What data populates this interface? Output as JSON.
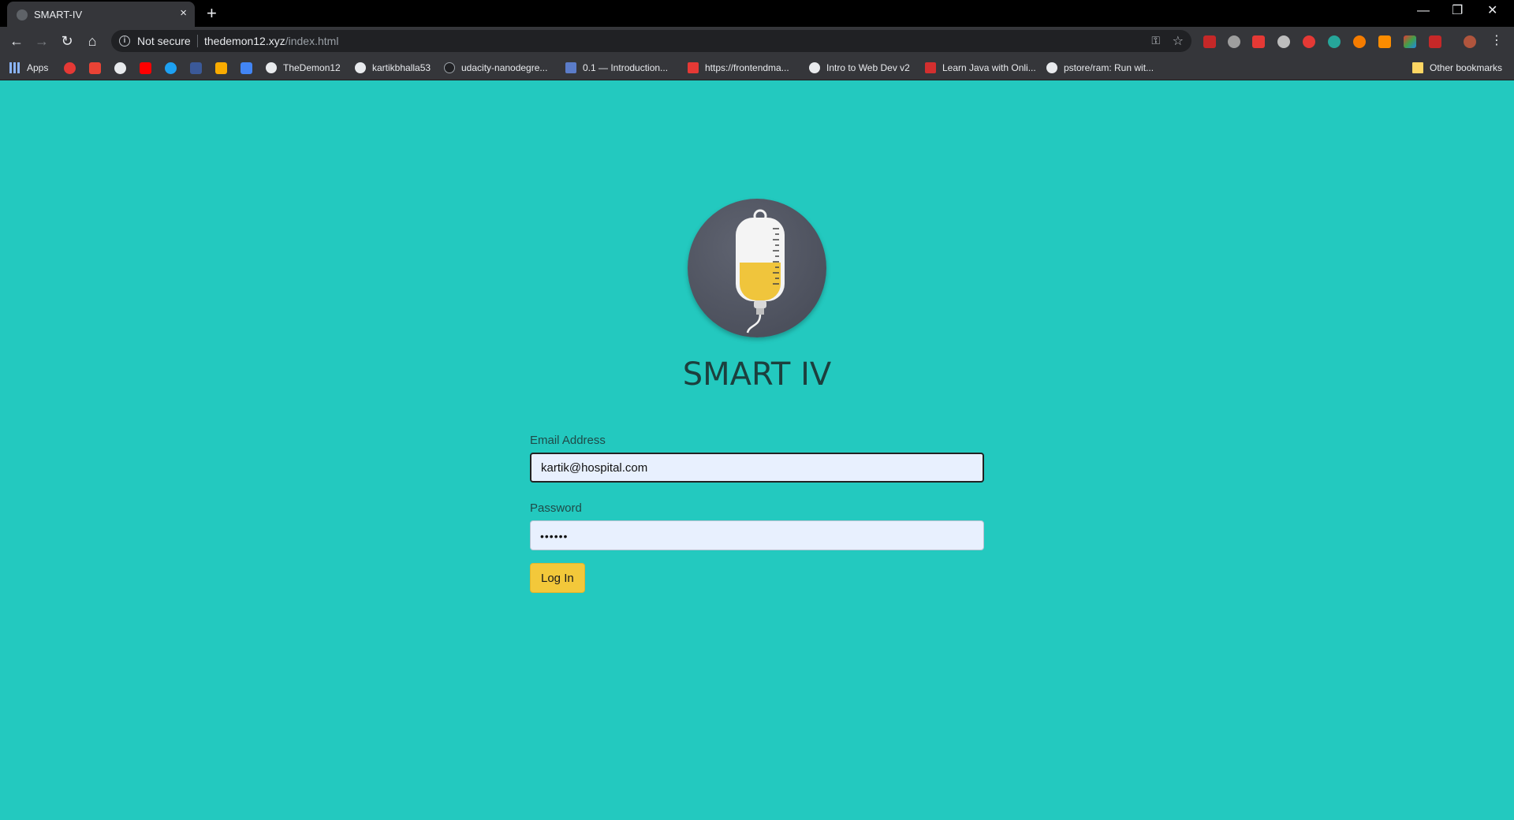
{
  "browser": {
    "tab_title": "SMART-IV",
    "tab_close": "×",
    "new_tab": "+",
    "window_controls": {
      "minimize": "—",
      "restore": "❐",
      "close": "✕"
    },
    "security_label": "Not secure",
    "url_host": "thedemon12.xyz",
    "url_path": "/index.html",
    "bookmarks": [
      {
        "label": "Apps",
        "icon": "apps-grid-icon",
        "color": "#e8eaed"
      },
      {
        "label": "TheDemon12",
        "icon": "github-icon",
        "color": "#e8eaed"
      },
      {
        "label": "kartikbhalla53",
        "icon": "github-icon",
        "color": "#e8eaed"
      },
      {
        "label": "udacity-nanodegre...",
        "icon": "github-icon",
        "color": "#e8eaed"
      },
      {
        "label": "0.1 — Introduction...",
        "icon": "cpp-icon",
        "color": "#5b7cc9"
      },
      {
        "label": "https://frontendma...",
        "icon": "fm-icon",
        "color": "#e53935"
      },
      {
        "label": "Intro to Web Dev v2",
        "icon": "globe-icon",
        "color": "#e8eaed"
      },
      {
        "label": "Learn Java with Onli...",
        "icon": "edx-icon",
        "color": "#d32f2f"
      },
      {
        "label": "pstore/ram: Run wit...",
        "icon": "github-icon",
        "color": "#e8eaed"
      }
    ],
    "other_bookmarks": "Other bookmarks"
  },
  "app": {
    "title": "SMART IV",
    "logo_icon": "iv-bag-icon"
  },
  "login": {
    "email_label": "Email Address",
    "email_value": "kartik@hospital.com",
    "password_label": "Password",
    "password_mask": "••••••",
    "submit_label": "Log In"
  },
  "colors": {
    "page_background": "#23c9bf",
    "button": "#f3c83a",
    "logo_circle": "#4f535f",
    "fluid": "#f0c53c"
  }
}
